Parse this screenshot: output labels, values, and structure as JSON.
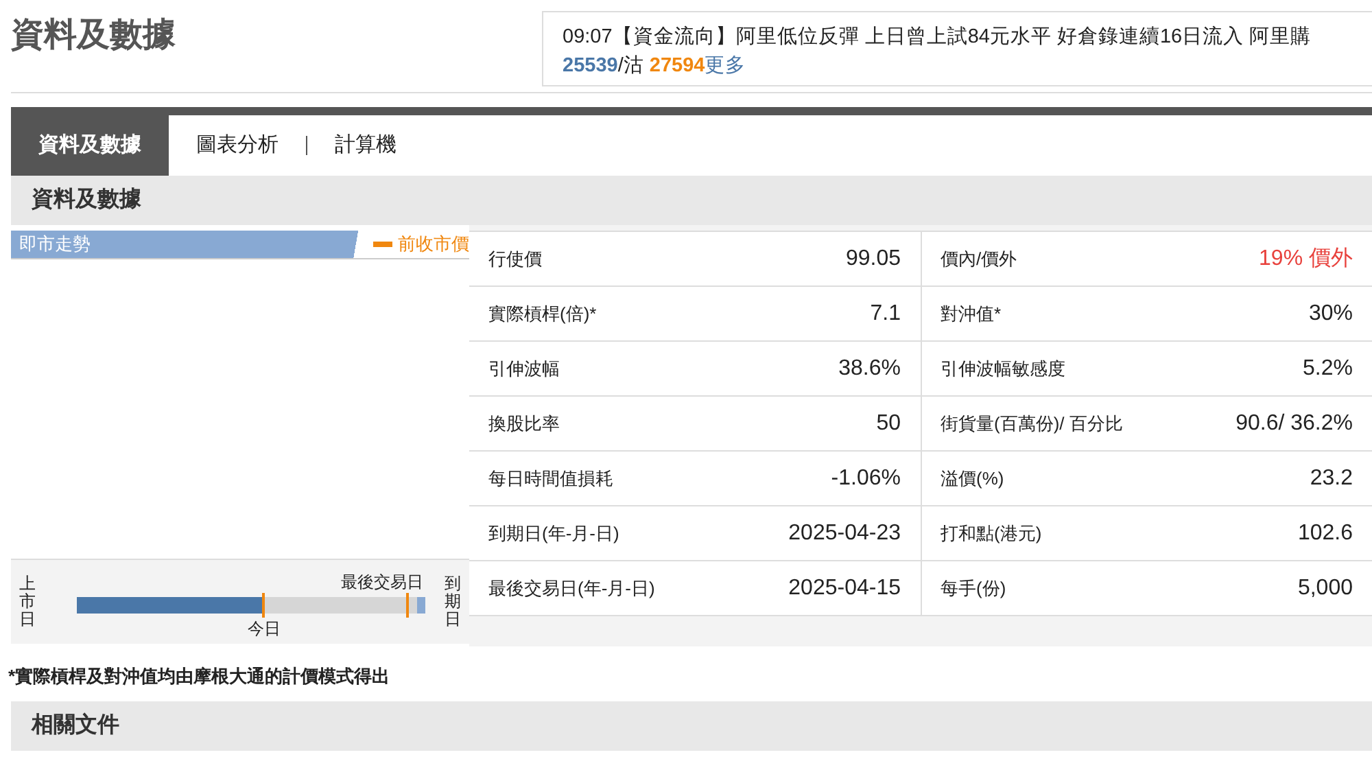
{
  "page_title": "資料及數據",
  "news": {
    "time": "09:07",
    "text": "【資金流向】阿里低位反彈 上日曾上試84元水平 好倉錄連續16日流入 阿里購",
    "bull_count": "25539",
    "separator": "/沽",
    "bear_count": "27594",
    "more_link": "更多"
  },
  "tabs": [
    {
      "label": "資料及數據",
      "selected": true
    },
    {
      "label": "圖表分析",
      "selected": false
    },
    {
      "label": "計算機",
      "selected": false
    }
  ],
  "section_title": "資料及數據",
  "chart": {
    "title": "即市走勢",
    "legend": "前收市價"
  },
  "timeline": {
    "start_label": "上市日",
    "end_label": "到期日",
    "today": {
      "label": "今日",
      "level": 0.55
    },
    "last_trading": {
      "label": "最後交易日",
      "level": 0.97
    }
  },
  "rows": [
    [
      {
        "label": "行使價",
        "value": "99.05",
        "highlight": false
      },
      {
        "label": "價內/價外",
        "value": "19% 價外",
        "highlight": true
      }
    ],
    [
      {
        "label": "實際槓桿(倍)*",
        "value": "7.1",
        "highlight": false
      },
      {
        "label": "對沖值*",
        "value": "30%",
        "highlight": false
      }
    ],
    [
      {
        "label": "引伸波幅",
        "value": "38.6%",
        "highlight": false
      },
      {
        "label": "引伸波幅敏感度",
        "value": "5.2%",
        "highlight": false
      }
    ],
    [
      {
        "label": "換股比率",
        "value": "50",
        "highlight": false
      },
      {
        "label": "街貨量(百萬份)/ 百分比",
        "value": "90.6/ 36.2%",
        "highlight": false
      }
    ],
    [
      {
        "label": "每日時間值損耗",
        "value": "-1.06%",
        "highlight": false
      },
      {
        "label": "溢價(%)",
        "value": "23.2",
        "highlight": false
      }
    ],
    [
      {
        "label": "到期日(年-月-日)",
        "value": "2025-04-23",
        "highlight": false
      },
      {
        "label": "打和點(港元)",
        "value": "102.6",
        "highlight": false
      }
    ],
    [
      {
        "label": "最後交易日(年-月-日)",
        "value": "2025-04-15",
        "highlight": false
      },
      {
        "label": "每手(份)",
        "value": "5,000",
        "highlight": false
      }
    ]
  ],
  "footnote": "*實際槓桿及對沖值均由摩根大通的計價模式得出",
  "related_title": "相關文件"
}
